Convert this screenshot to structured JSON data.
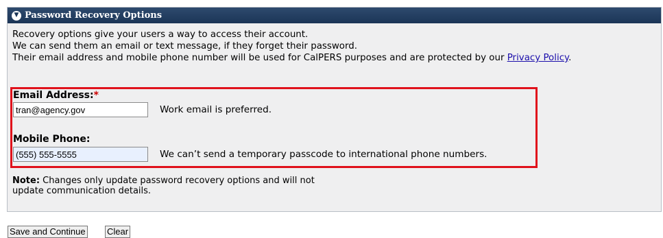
{
  "panel": {
    "title": "Password Recovery Options",
    "intro_line1": "Recovery options give your users a way to access their account.",
    "intro_line2": "We can send them an email or text message, if they forget their password.",
    "intro_line3": "Their email address and mobile phone number will be used for CalPERS purposes and are protected by our ",
    "privacy_link": "Privacy Policy",
    "intro_period": "."
  },
  "email": {
    "label": "Email Address:",
    "required_mark": "*",
    "value": "tran@agency.gov",
    "help": "Work email is preferred."
  },
  "phone": {
    "label": "Mobile Phone:",
    "value": "(555) 555-5555",
    "help": "We can’t send a temporary passcode to international phone numbers."
  },
  "note": {
    "bold": "Note:",
    "line1": " Changes only update password recovery options and will not",
    "line2": "update communication details."
  },
  "buttons": {
    "save": "Save and Continue",
    "clear": "Clear"
  },
  "colors": {
    "header_bg": "#1b3556",
    "highlight_border": "#e0111b",
    "panel_bg": "#efeff0",
    "link": "#1a0dab"
  }
}
